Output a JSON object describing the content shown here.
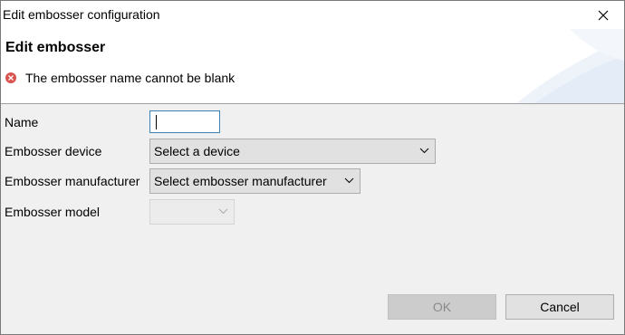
{
  "window": {
    "title": "Edit embosser configuration"
  },
  "banner": {
    "title": "Edit embosser",
    "error_message": "The embosser name cannot be blank"
  },
  "form": {
    "name_label": "Name",
    "name_value": "",
    "device_label": "Embosser device",
    "device_value": "Select a device",
    "manufacturer_label": "Embosser manufacturer",
    "manufacturer_value": "Select embosser manufacturer",
    "model_label": "Embosser model",
    "model_value": ""
  },
  "buttons": {
    "ok_label": "OK",
    "cancel_label": "Cancel"
  },
  "colors": {
    "error": "#d9534f",
    "focus_border": "#3c7fb1"
  }
}
